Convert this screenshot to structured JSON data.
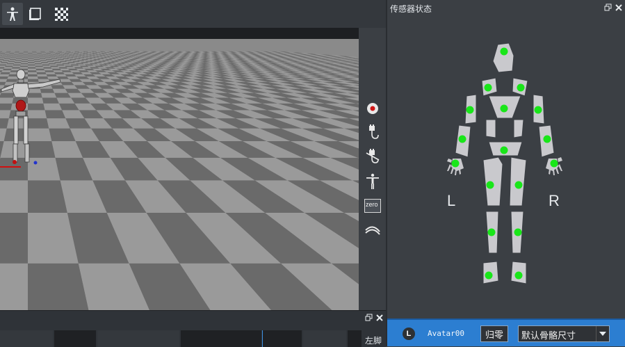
{
  "toolbar": {
    "buttons": [
      {
        "icon": "figure-icon",
        "active": true
      },
      {
        "icon": "single-window-icon",
        "active": false
      },
      {
        "icon": "checkerboard-icon",
        "active": false
      }
    ]
  },
  "side_tools": [
    {
      "icon": "record-icon"
    },
    {
      "icon": "connect-plug-icon"
    },
    {
      "icon": "disconnect-plug-icon"
    },
    {
      "icon": "t-pose-icon"
    },
    {
      "icon": "zero-icon",
      "label": "zero"
    },
    {
      "icon": "layers-icon"
    }
  ],
  "bottom_panel": {
    "label": "左脚"
  },
  "sensor_panel": {
    "title": "传感器状态",
    "left_label": "L",
    "right_label": "R",
    "sensor_color": "#19e619",
    "segment_color": "#c9c9cd"
  },
  "statusbar": {
    "badge": "L",
    "avatar_name": "Avatar00",
    "zero_button": "归零",
    "skeleton_select": "默认骨骼尺寸"
  },
  "colors": {
    "accent": "#2c7ed1",
    "panel_bg": "#3b3f44"
  }
}
